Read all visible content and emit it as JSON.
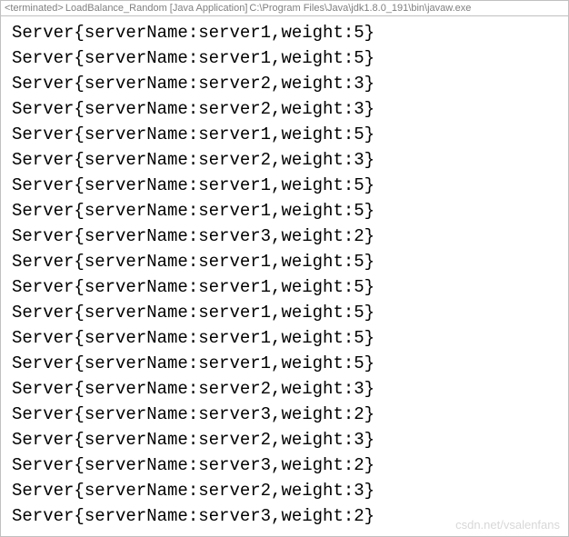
{
  "header": {
    "status": "<terminated>",
    "app_name": "LoadBalance_Random [Java Application]",
    "path": "C:\\Program Files\\Java\\jdk1.8.0_191\\bin\\javaw.exe"
  },
  "console": {
    "lines": [
      "Server{serverName:server1,weight:5}",
      "Server{serverName:server1,weight:5}",
      "Server{serverName:server2,weight:3}",
      "Server{serverName:server2,weight:3}",
      "Server{serverName:server1,weight:5}",
      "Server{serverName:server2,weight:3}",
      "Server{serverName:server1,weight:5}",
      "Server{serverName:server1,weight:5}",
      "Server{serverName:server3,weight:2}",
      "Server{serverName:server1,weight:5}",
      "Server{serverName:server1,weight:5}",
      "Server{serverName:server1,weight:5}",
      "Server{serverName:server1,weight:5}",
      "Server{serverName:server1,weight:5}",
      "Server{serverName:server2,weight:3}",
      "Server{serverName:server3,weight:2}",
      "Server{serverName:server2,weight:3}",
      "Server{serverName:server3,weight:2}",
      "Server{serverName:server2,weight:3}",
      "Server{serverName:server3,weight:2}"
    ]
  },
  "watermark": "csdn.net/vsalenfans"
}
